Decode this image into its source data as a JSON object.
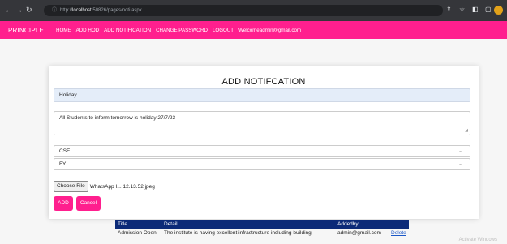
{
  "browser": {
    "url_prefix": "http://",
    "url_host": "localhost",
    "url_path": ":50826/pages/noti.aspx"
  },
  "nav": {
    "brand": "PRINCIPLE",
    "links": [
      "HOME",
      "ADD HOD",
      "ADD NOTIFICATION",
      "CHANGE PASSWORD",
      "LOGOUT",
      "Welcomeadmin@gmail.com"
    ]
  },
  "form": {
    "heading": "ADD NOTIFCATION",
    "title_value": "Holiday",
    "detail_value": "All Students to inform tomorrow is holiday 27/7/23",
    "select1_value": "CSE",
    "select2_value": "FY",
    "choose_file_label": "Choose File",
    "file_name": "WhatsApp I... 12.13.52.jpeg",
    "add_label": "ADD",
    "cancel_label": "Cancel"
  },
  "table": {
    "headers": [
      "Title",
      "Detail",
      "Addedby"
    ],
    "rows": [
      {
        "title": "Admission Open",
        "detail": "The institute is having excellent infrastructure including building",
        "addedby": "admin@gmail.com",
        "action": "Delete"
      }
    ]
  },
  "watermark": "Activate Windows"
}
